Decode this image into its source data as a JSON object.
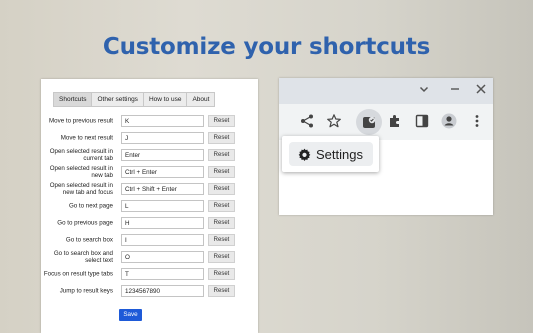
{
  "headline": "Customize your shortcuts",
  "colors": {
    "headline": "#2f62ad",
    "save_button": "#1e5ad8",
    "panel_bg": "#ffffff"
  },
  "settings_panel": {
    "tabs": [
      {
        "label": "Shortcuts",
        "active": true
      },
      {
        "label": "Other settings",
        "active": false
      },
      {
        "label": "How to use",
        "active": false
      },
      {
        "label": "About",
        "active": false
      }
    ],
    "reset_label": "Reset",
    "rows": [
      {
        "label": "Move to previous result",
        "value": "K"
      },
      {
        "label": "Move to next result",
        "value": "J"
      },
      {
        "label": "Open selected result in current tab",
        "value": "Enter"
      },
      {
        "label": "Open selected result in new tab",
        "value": "Ctrl + Enter"
      },
      {
        "label": "Open selected result in new tab and focus",
        "value": "Ctrl + Shift + Enter"
      },
      {
        "label": "Go to next page",
        "value": "L"
      },
      {
        "label": "Go to previous page",
        "value": "H"
      },
      {
        "label": "Go to search box",
        "value": "I"
      },
      {
        "label": "Go to search box and select text",
        "value": "O"
      },
      {
        "label": "Focus on result type tabs",
        "value": "T"
      },
      {
        "label": "Jump to result keys",
        "value": "1234567890"
      }
    ],
    "save_label": "Save"
  },
  "browser": {
    "window_controls": [
      "chevron-down-icon",
      "minimize-icon",
      "close-icon"
    ],
    "toolbar_icons": [
      "share-icon",
      "star-icon",
      "extension-shortcut-icon",
      "puzzle-icon",
      "side-panel-icon",
      "profile-icon",
      "kebab-menu-icon"
    ],
    "popup_button_label": "Settings"
  }
}
